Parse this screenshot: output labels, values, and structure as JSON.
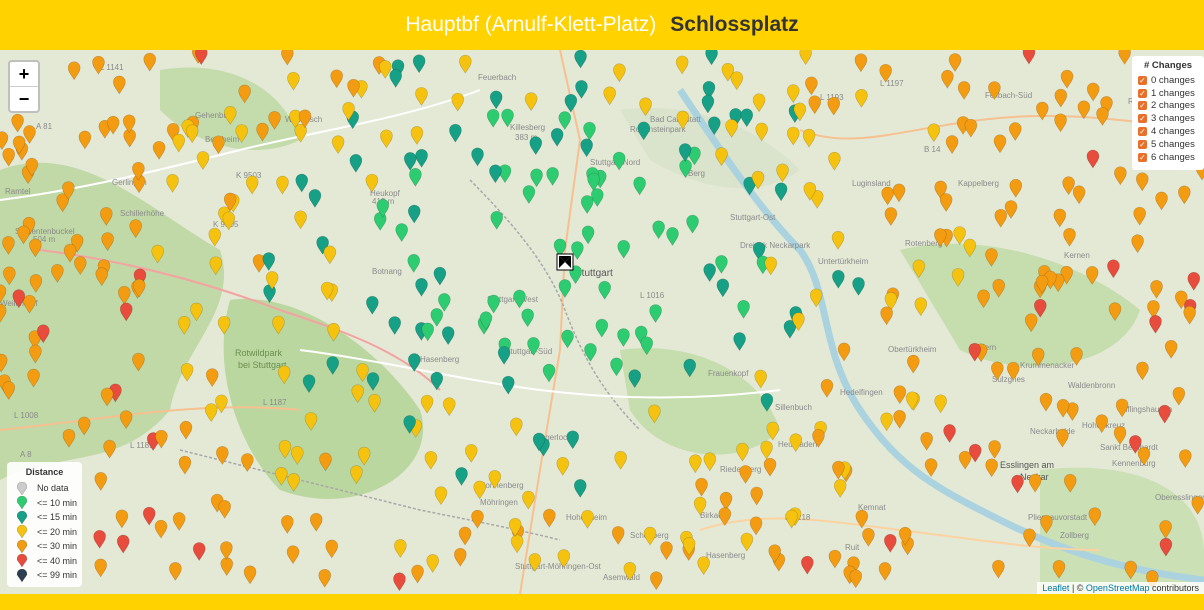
{
  "header": {
    "origin": "Hauptbf (Arnulf-Klett-Platz)",
    "destination": "Schlossplatz"
  },
  "zoom": {
    "in_label": "+",
    "out_label": "−"
  },
  "layers": {
    "title": "# Changes",
    "items": [
      "0 changes",
      "1 changes",
      "2 changes",
      "3 changes",
      "4 changes",
      "5 changes",
      "6 changes"
    ]
  },
  "legend": {
    "title": "Distance",
    "items": [
      {
        "label": "No data",
        "color": "#cccccc"
      },
      {
        "label": "<= 10 min",
        "color": "#2ecc71"
      },
      {
        "label": "<= 15 min",
        "color": "#16a085"
      },
      {
        "label": "<= 20 min",
        "color": "#f5c30f"
      },
      {
        "label": "<= 30 min",
        "color": "#f39c12"
      },
      {
        "label": "<= 40 min",
        "color": "#e74c3c"
      },
      {
        "label": "<= 99 min",
        "color": "#2c3e50"
      }
    ]
  },
  "attribution": {
    "leaflet": "Leaflet",
    "separator": " | © ",
    "osm": "OpenStreetMap",
    "suffix": " contributors"
  },
  "map_labels": [
    "L 1141",
    "Feuerbach",
    "Killesberg",
    "383 m",
    "Rosensteinpark",
    "Bad Cannstatt",
    "Stuttgart-Nord",
    "Gehenbühl",
    "Wolfbusch",
    "Bergheim",
    "Gerlingen",
    "A 81",
    "Ramtel",
    "K 9503",
    "Heukopf",
    "412 m",
    "Schillerhöhe",
    "Studentenbuckel",
    "504 m",
    "K 9505",
    "Berg",
    "Stuttgart-Ost",
    "Dreieck Neckarpark",
    "Stuttgart",
    "Botnang",
    "Stuttgart-Süd",
    "Stuttgart-West",
    "Rotwildpark bei Stuttgart",
    "Hasenberg",
    "Frauenkopf",
    "Heumaden",
    "Degerloch",
    "Sonnenberg",
    "Möhringen",
    "Stuttgart-Möhringen-Ost",
    "Hohenheim",
    "Asemwald",
    "Schönberg",
    "Birkach",
    "Hasenberg",
    "Kernen",
    "Luginsland",
    "Rotenberg",
    "Untertürkheim",
    "Obertürkheim",
    "Fellbach-Süd",
    "Esslingen am Neckar",
    "Rüdern",
    "Krummenacker",
    "Sulzgries",
    "Waldenbronn",
    "Wiflingshausen",
    "Neckarhalde",
    "Hohenkreuz",
    "Sankt Bernhardt",
    "Kennenburg",
    "Oberesslingen",
    "Pliensauvorstadt",
    "Zollberg",
    "Ruit",
    "Kemnat",
    "Riedenberg",
    "Sillenbuch",
    "Hedelfingen",
    "B 14",
    "L 1193",
    "L 1197",
    "K 1218",
    "L 1016",
    "L 1187",
    "L 1189",
    "L 1008",
    "A 8",
    "Rommelshausen",
    "K 1199",
    "Kappelberg",
    "Weilimdorf"
  ]
}
